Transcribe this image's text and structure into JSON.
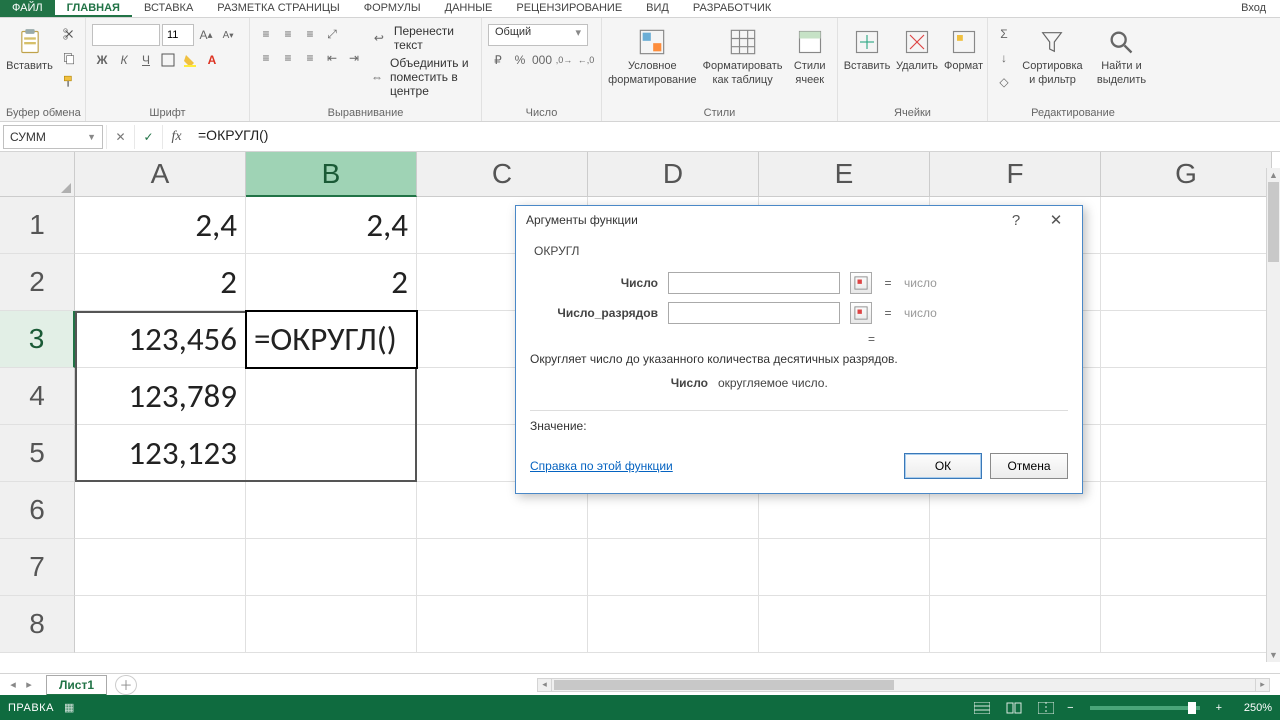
{
  "tabs": {
    "file": "ФАЙЛ",
    "items": [
      "ГЛАВНАЯ",
      "ВСТАВКА",
      "РАЗМЕТКА СТРАНИЦЫ",
      "ФОРМУЛЫ",
      "ДАННЫЕ",
      "РЕЦЕНЗИРОВАНИЕ",
      "ВИД",
      "РАЗРАБОТЧИК"
    ],
    "active_index": 0,
    "login": "Вход"
  },
  "ribbon": {
    "clipboard": {
      "label": "Буфер обмена",
      "paste": "Вставить"
    },
    "font": {
      "label": "Шрифт",
      "family": "",
      "size": "11"
    },
    "alignment": {
      "label": "Выравнивание",
      "wrap": "Перенести текст",
      "merge": "Объединить и поместить в центре"
    },
    "number": {
      "label": "Число",
      "format": "Общий"
    },
    "styles": {
      "label": "Стили",
      "cond": "Условное форматирование",
      "table": "Форматировать как таблицу",
      "cell": "Стили ячеек"
    },
    "cells": {
      "label": "Ячейки",
      "insert": "Вставить",
      "delete": "Удалить",
      "format": "Формат"
    },
    "editing": {
      "label": "Редактирование",
      "sort": "Сортировка и фильтр",
      "find": "Найти и выделить"
    }
  },
  "fbar": {
    "namebox": "СУММ",
    "formula": "=ОКРУГЛ()"
  },
  "grid": {
    "cols": [
      "A",
      "B",
      "C",
      "D",
      "E",
      "F",
      "G"
    ],
    "rows": [
      "1",
      "2",
      "3",
      "4",
      "5",
      "6",
      "7",
      "8"
    ],
    "selected_col": 1,
    "selected_row": 2,
    "cells": {
      "A1": "2,4",
      "B1": "2,4",
      "A2": "2",
      "B2": "2",
      "A3": "123,456",
      "B3": "=ОКРУГЛ()",
      "A4": "123,789",
      "A5": "123,123"
    }
  },
  "dialog": {
    "title": "Аргументы функции",
    "fn_name": "ОКРУГЛ",
    "args": [
      {
        "label": "Число",
        "value": "",
        "type": "число"
      },
      {
        "label": "Число_разрядов",
        "value": "",
        "type": "число"
      }
    ],
    "result_eq": "=",
    "description": "Округляет число до указанного количества десятичных разрядов.",
    "arg_name": "Число",
    "arg_desc": "округляемое число.",
    "value_label": "Значение:",
    "link": "Справка по этой функции",
    "ok": "ОК",
    "cancel": "Отмена"
  },
  "sheetbar": {
    "active": "Лист1"
  },
  "status": {
    "mode": "ПРАВКА",
    "zoom": "250%"
  }
}
